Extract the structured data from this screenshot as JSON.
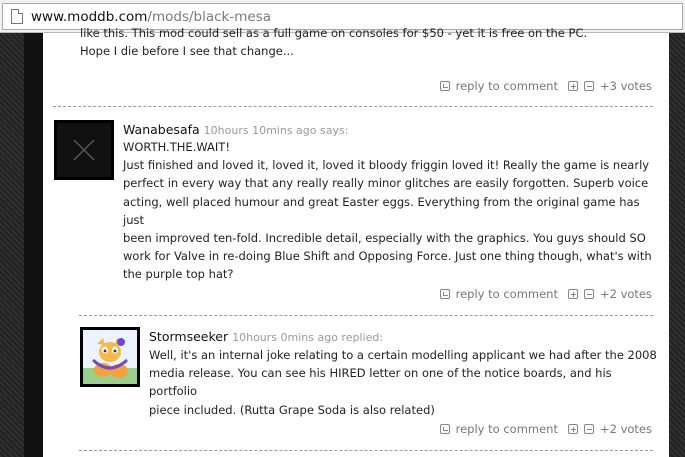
{
  "browser": {
    "url_host": "www.moddb.com",
    "url_path": "/mods/black-mesa"
  },
  "top_comment": {
    "cut_lines": [
      "like this. This mod could sell as a full game on consoles for $50 - yet it is free on the PC.",
      "Hope I die before I see that change..."
    ],
    "actions": {
      "reply": "reply to comment",
      "votes": "+3 votes"
    }
  },
  "comment1": {
    "author": "Wanabesafa",
    "meta": "10hours 10mins ago says:",
    "body_lines": [
      "WORTH.THE.WAIT!",
      "Just finished and loved it, loved it, loved it bloody friggin loved it! Really the game is nearly",
      "perfect in every way that any really really minor glitches are easily forgotten. Superb voice",
      "acting, well placed humour and great Easter eggs. Everything from the original game has just",
      "been improved ten-fold. Incredible detail, especially with the graphics. You guys should SO",
      "work for Valve in re-doing Blue Shift and Opposing Force. Just one thing though, what's with",
      "the purple top hat?"
    ],
    "actions": {
      "reply": "reply to comment",
      "votes": "+2 votes"
    }
  },
  "comment2": {
    "author": "Stormseeker",
    "meta": "10hours 0mins ago replied:",
    "body_lines": [
      "Well, it's an internal joke relating to a certain modelling applicant we had after the 2008",
      "media release. You can see his HIRED letter on one of the notice boards, and his portfolio",
      "piece included. (Rutta Grape Soda is also related)"
    ],
    "actions": {
      "reply": "reply to comment",
      "votes": "+2 votes"
    }
  }
}
